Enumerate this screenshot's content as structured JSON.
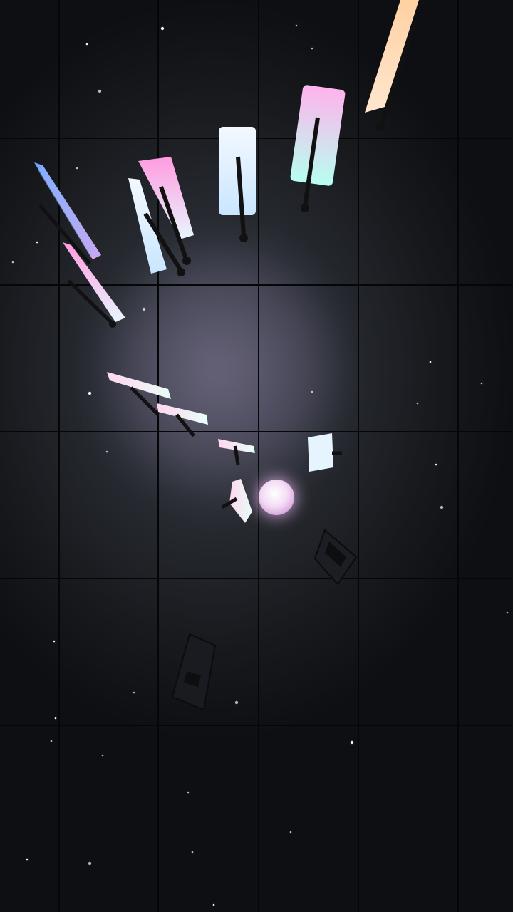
{
  "scene": {
    "type": "3d-physics-domino-sim",
    "background_color": "#16181c",
    "grid_line_color": "#050607",
    "ball_color": "#f2d6f2",
    "panel_colors": [
      "#6ea8ff",
      "#ff9be0",
      "#e8f6ff",
      "#c9ffe8",
      "#ffd1a3",
      "#ffb3ec",
      "#b7fff0"
    ],
    "knocked_panel_color": "#1d1f24",
    "star_color": "#ffffff"
  }
}
